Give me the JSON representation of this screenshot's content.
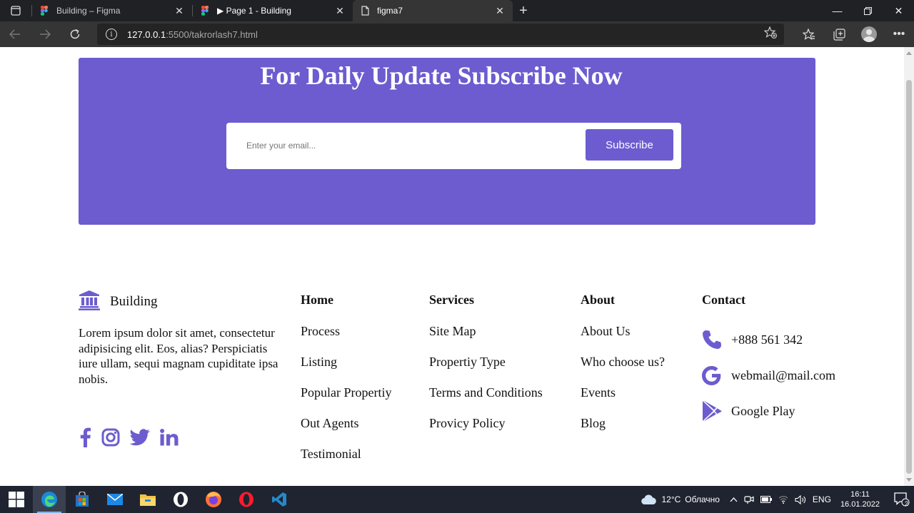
{
  "browser": {
    "tabs": [
      {
        "title": "Building – Figma",
        "icon": "figma-icon"
      },
      {
        "title": "▶ Page 1 - Building",
        "icon": "figma-icon"
      },
      {
        "title": "figma7",
        "icon": "page-icon",
        "active": true
      }
    ],
    "url_host": "127.0.0.1",
    "url_rest": ":5500/takrorlash7.html"
  },
  "subscribe": {
    "heading": "For Daily Update Subscribe Now",
    "placeholder": "Enter your email...",
    "button_label": "Subscribe",
    "bg_color": "#6c5ccf"
  },
  "footer": {
    "brand_name": "Building",
    "about_text": "Lorem ipsum dolor sit amet, consectetur adipisicing elit. Eos, alias? Perspiciatis iure ullam, sequi magnam cupiditate ipsa nobis.",
    "socials": [
      "facebook-icon",
      "instagram-icon",
      "twitter-icon",
      "linkedin-icon"
    ],
    "columns": {
      "home": {
        "heading": "Home",
        "links": [
          "Process",
          "Listing",
          "Popular Propertiy",
          "Out Agents",
          "Testimonial"
        ]
      },
      "services": {
        "heading": "Services",
        "links": [
          "Site Map",
          "Propertiy Type",
          "Terms and Conditions",
          "Provicy Policy"
        ]
      },
      "about": {
        "heading": "About",
        "links": [
          "About Us",
          "Who choose us?",
          "Events",
          "Blog"
        ]
      },
      "contact": {
        "heading": "Contact",
        "phone": "+888 561 342",
        "email": "webmail@mail.com",
        "store": "Google Play"
      }
    },
    "accent_color": "#6c5ccf"
  },
  "taskbar": {
    "weather_temp": "12°C",
    "weather_text": "Облачно",
    "lang": "ENG",
    "time": "16:11",
    "date": "16.01.2022",
    "notifications": "2"
  }
}
